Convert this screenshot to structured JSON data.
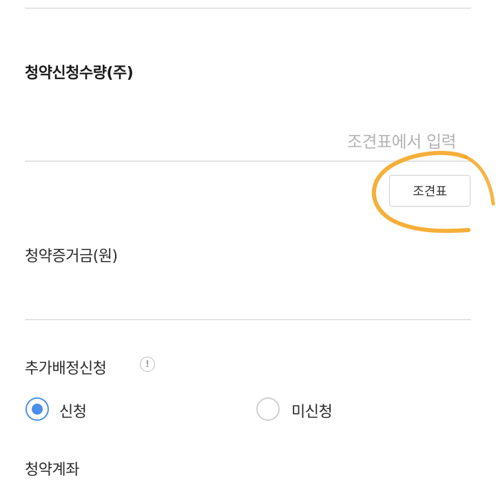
{
  "form": {
    "quantity": {
      "label": "청약신청수량(주)",
      "placeholder": "조견표에서 입력",
      "button_label": "조견표"
    },
    "deposit": {
      "label": "청약증거금(원)",
      "value": ""
    },
    "additional_allocation": {
      "label": "추가배정신청",
      "info_glyph": "!",
      "options": [
        {
          "label": "신청",
          "selected": true
        },
        {
          "label": "미신청",
          "selected": false
        }
      ]
    },
    "account": {
      "label": "청약계좌"
    }
  },
  "annotation": {
    "highlight_color": "#f5a623"
  },
  "colors": {
    "accent": "#4a8ee8",
    "divider": "#e3e3e3",
    "placeholder": "#b4b4b4"
  }
}
